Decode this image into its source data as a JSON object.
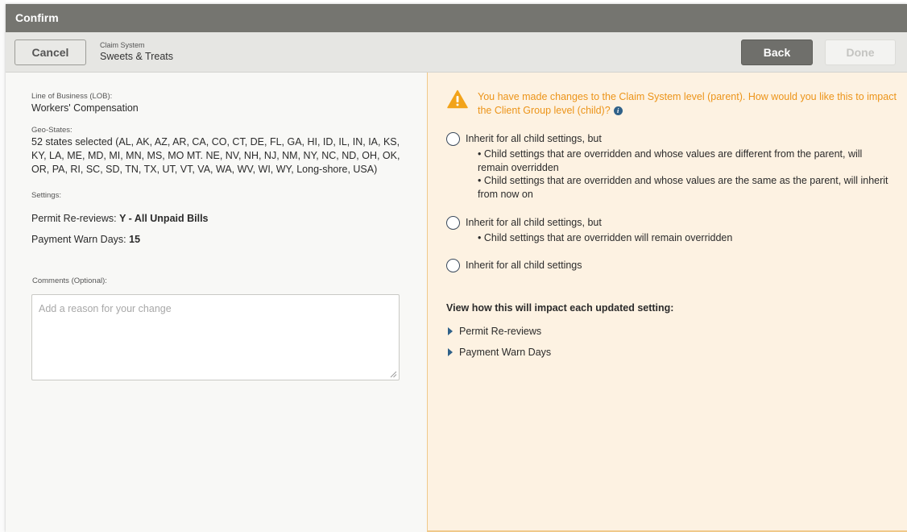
{
  "dialog": {
    "title": "Confirm"
  },
  "toolbar": {
    "cancel_label": "Cancel",
    "back_label": "Back",
    "done_label": "Done",
    "crumb_small": "Claim System",
    "crumb_main": "Sweets & Treats"
  },
  "summary": {
    "lob_label": "Line of Business (LOB):",
    "lob_value": "Workers' Compensation",
    "geo_label": "Geo-States:",
    "geo_value": "52 states selected (AL, AK, AZ, AR, CA, CO, CT, DE, FL, GA, HI, ID, IL, IN, IA, KS, KY, LA, ME, MD, MI, MN, MS, MO MT. NE, NV, NH, NJ, NM, NY, NC, ND, OH, OK, OR, PA, RI, SC, SD, TN, TX, UT, VT, VA, WA, WV, WI, WY, Long-shore, USA)",
    "settings_label": "Settings:",
    "setting1_name": "Permit Re-reviews:",
    "setting1_value": "Y - All Unpaid Bills",
    "setting2_name": "Payment Warn Days:",
    "setting2_value": "15",
    "comments_label": "Comments (Optional):",
    "comments_placeholder": "Add a reason for your change",
    "comments_value": ""
  },
  "impact": {
    "warning": "You have made changes to the Claim System level (parent). How would you like this to impact the Client Group level (child)?",
    "warning_color": "#ec9419",
    "options": [
      {
        "label": "Inherit for all child settings, but",
        "bullets": [
          "• Child settings that are overridden and whose values are different from the parent, will remain overridden",
          "• Child settings that are overridden and whose values are the same as the parent, will inherit from now on"
        ]
      },
      {
        "label": "Inherit for all child settings, but",
        "bullets": [
          "• Child settings that are overridden will remain overridden"
        ]
      },
      {
        "label": "Inherit for all child settings",
        "bullets": []
      }
    ],
    "impact_heading": "View how this will impact each updated setting:",
    "expanders": [
      "Permit Re-reviews",
      "Payment Warn Days"
    ]
  },
  "icons": {
    "warning": "warning-triangle-icon",
    "info": "info-icon",
    "expand": "caret-right-icon",
    "resize": "resize-grip-icon"
  }
}
